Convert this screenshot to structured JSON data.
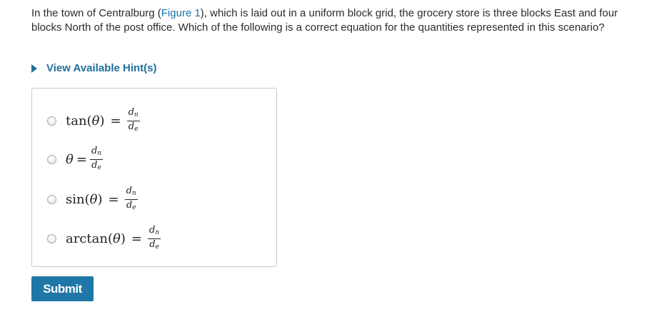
{
  "question": {
    "prefix": "In the town of Centralburg (",
    "figure_link": "Figure 1",
    "suffix": "), which is laid out in a uniform block grid, the grocery store is three blocks East and four blocks North of the post office. Which of the following is a correct equation for the quantities represented in this scenario?"
  },
  "hints": {
    "label": "View Available Hint(s)"
  },
  "options": [
    {
      "lhs": "tan(",
      "var": "θ",
      "rhs_close": ")",
      "eq": "=",
      "num": "d",
      "num_sub": "n",
      "den": "d",
      "den_sub": "e"
    },
    {
      "lhs": "",
      "var": "θ",
      "rhs_close": "",
      "eq": "=",
      "num": "d",
      "num_sub": "n",
      "den": "d",
      "den_sub": "e"
    },
    {
      "lhs": "sin(",
      "var": "θ",
      "rhs_close": ")",
      "eq": "=",
      "num": "d",
      "num_sub": "n",
      "den": "d",
      "den_sub": "e"
    },
    {
      "lhs": "arctan(",
      "var": "θ",
      "rhs_close": ")",
      "eq": "=",
      "num": "d",
      "num_sub": "n",
      "den": "d",
      "den_sub": "e"
    }
  ],
  "submit": {
    "label": "Submit"
  },
  "colors": {
    "link": "#1a73a8",
    "hint": "#1f6f9a",
    "button": "#1f77a8"
  }
}
